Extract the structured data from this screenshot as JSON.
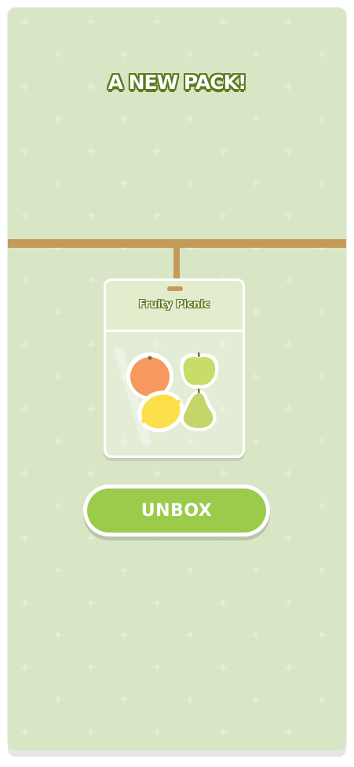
{
  "screen": {
    "headline": "A NEW PACK!",
    "pack": {
      "name": "Fruity Picnic",
      "contents": [
        "orange",
        "apple",
        "lemon",
        "pear"
      ]
    },
    "unbox_label": "UNBOX"
  },
  "colors": {
    "background": "#d9e6c6",
    "headline_outline": "#5b7d1e",
    "rail": "#c49a5b",
    "pack_header": "#e3edce",
    "button": "#9acb4b",
    "orange": "#f5995e",
    "apple": "#c7dc69",
    "lemon": "#fbe04b",
    "pear": "#c5d568"
  }
}
